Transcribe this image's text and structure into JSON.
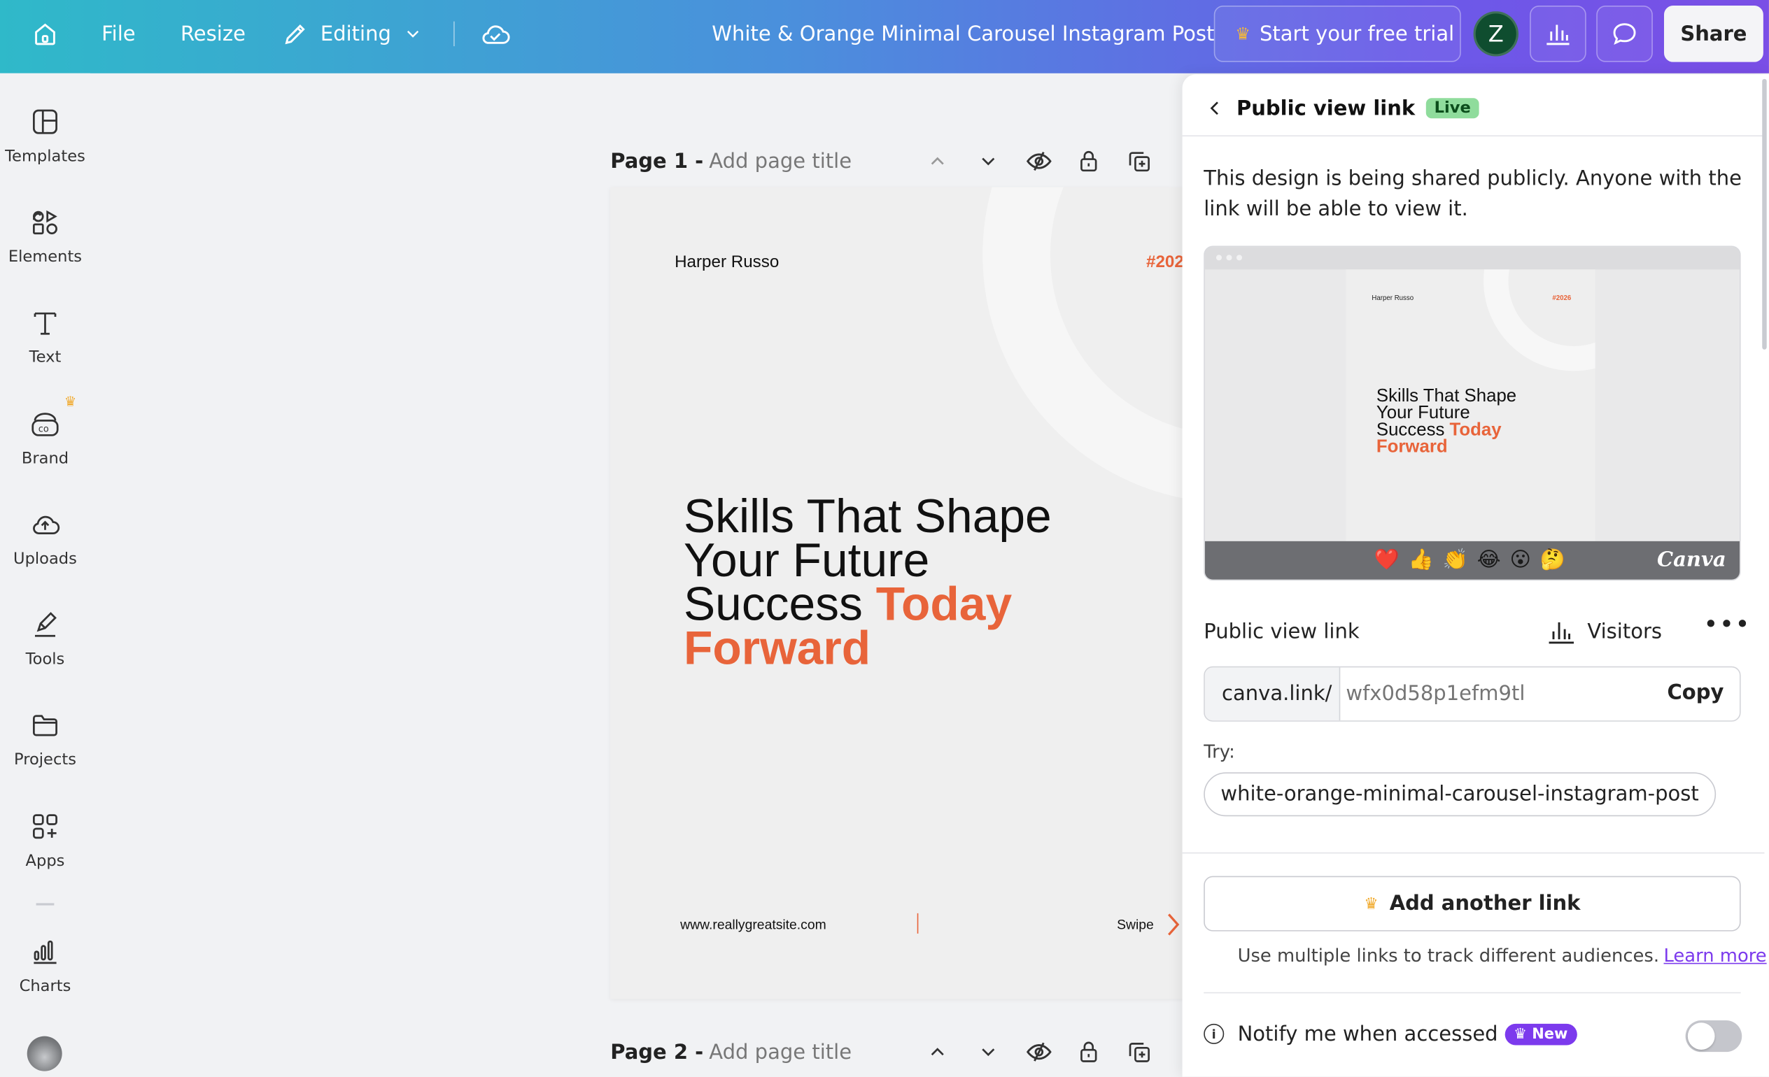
{
  "topbar": {
    "file": "File",
    "resize": "Resize",
    "editing": "Editing",
    "title": "White & Orange Minimal Carousel Instagram Post",
    "trial": "Start your free trial",
    "avatar_initial": "Z",
    "share": "Share"
  },
  "sidebar": {
    "items": [
      {
        "label": "Templates",
        "icon": "templates-icon"
      },
      {
        "label": "Elements",
        "icon": "elements-icon"
      },
      {
        "label": "Text",
        "icon": "text-icon"
      },
      {
        "label": "Brand",
        "icon": "brand-icon"
      },
      {
        "label": "Uploads",
        "icon": "uploads-icon"
      },
      {
        "label": "Tools",
        "icon": "tools-icon"
      },
      {
        "label": "Projects",
        "icon": "projects-icon"
      },
      {
        "label": "Apps",
        "icon": "apps-icon"
      },
      {
        "label": "Charts",
        "icon": "charts-icon"
      }
    ]
  },
  "pages": [
    {
      "label": "Page 1 -",
      "placeholder": "Add page title"
    },
    {
      "label": "Page 2 -",
      "placeholder": "Add page title"
    }
  ],
  "design": {
    "name": "Harper Russo",
    "tag": "#202",
    "headline_line1": "Skills That Shape",
    "headline_line2": "Your Future",
    "headline_line3_black": "Success ",
    "headline_line3_orange": "Today",
    "headline_line4_orange": "Forward",
    "url": "www.reallygreatsite.com",
    "swipe": "Swipe"
  },
  "panel": {
    "title": "Public view link",
    "live_badge": "Live",
    "description": "This design is being shared publicly. Anyone with the link will be able to view it.",
    "preview": {
      "name": "Harper Russo",
      "tag": "#2026",
      "line1": "Skills That Shape",
      "line2": "Your Future",
      "line3_black": "Success ",
      "line3_orange": "Today",
      "line4_orange": "Forward",
      "emojis": [
        "❤️",
        "👍",
        "👏",
        "😂",
        "😮",
        "🤔"
      ],
      "brand": "Canva"
    },
    "link_label": "Public view link",
    "visitors": "Visitors",
    "link_prefix": "canva.link/",
    "link_placeholder": "wfx0d58p1efm9tl",
    "copy": "Copy",
    "try_label": "Try:",
    "try_suggestion": "white-orange-minimal-carousel-instagram-post",
    "add_link": "Add another link",
    "multi_text": "Use multiple links to track different audiences.",
    "learn_more": "Learn more",
    "notify_label": "Notify me when accessed",
    "new_badge": "New",
    "notify_enabled": false
  },
  "colors": {
    "accent_orange": "#e8643a",
    "new_badge": "#7c3aed",
    "live_badge": "#8fdc9c"
  }
}
